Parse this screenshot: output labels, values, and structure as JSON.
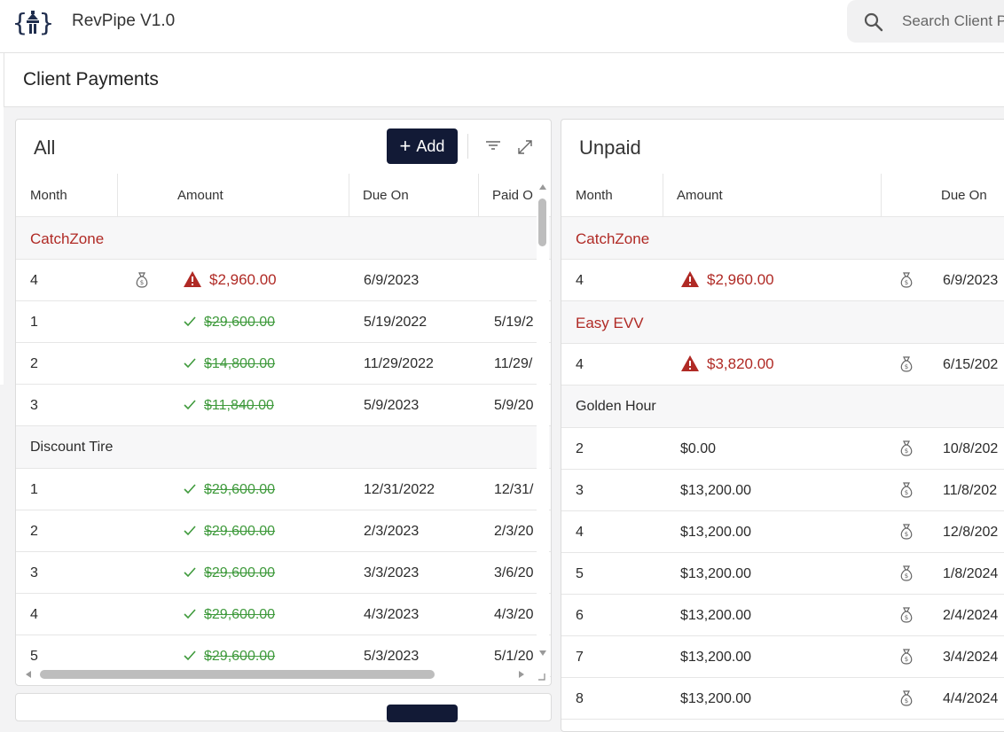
{
  "app": {
    "title": "RevPipe V1.0"
  },
  "search": {
    "placeholder": "Search Client P"
  },
  "page": {
    "title": "Client Payments"
  },
  "all_panel": {
    "title": "All",
    "add_label": "Add",
    "columns": [
      "Month",
      "Amount",
      "Due On",
      "Paid O"
    ],
    "rows": [
      {
        "type": "group",
        "name": "CatchZone",
        "color": "#b02a25"
      },
      {
        "type": "data",
        "month": "4",
        "status": "overdue",
        "money_icon": true,
        "amount": "$2,960.00",
        "due": "6/9/2023",
        "paid": ""
      },
      {
        "type": "data",
        "month": "1",
        "status": "paid",
        "amount": "$29,600.00",
        "due": "5/19/2022",
        "paid": "5/19/2"
      },
      {
        "type": "data",
        "month": "2",
        "status": "paid",
        "amount": "$14,800.00",
        "due": "11/29/2022",
        "paid": "11/29/"
      },
      {
        "type": "data",
        "month": "3",
        "status": "paid",
        "amount": "$11,840.00",
        "due": "5/9/2023",
        "paid": "5/9/20"
      },
      {
        "type": "group",
        "name": "Discount Tire",
        "color": "#2b2b2b"
      },
      {
        "type": "data",
        "month": "1",
        "status": "paid",
        "amount": "$29,600.00",
        "due": "12/31/2022",
        "paid": "12/31/"
      },
      {
        "type": "data",
        "month": "2",
        "status": "paid",
        "amount": "$29,600.00",
        "due": "2/3/2023",
        "paid": "2/3/20"
      },
      {
        "type": "data",
        "month": "3",
        "status": "paid",
        "amount": "$29,600.00",
        "due": "3/3/2023",
        "paid": "3/6/20"
      },
      {
        "type": "data",
        "month": "4",
        "status": "paid",
        "amount": "$29,600.00",
        "due": "4/3/2023",
        "paid": "4/3/20"
      },
      {
        "type": "data",
        "month": "5",
        "status": "paid",
        "amount": "$29,600.00",
        "due": "5/3/2023",
        "paid": "5/1/20"
      }
    ]
  },
  "unpaid_panel": {
    "title": "Unpaid",
    "columns": [
      "Month",
      "Amount",
      "Due On"
    ],
    "rows": [
      {
        "type": "group",
        "name": "CatchZone",
        "color": "#b02a25"
      },
      {
        "type": "data",
        "month": "4",
        "status": "overdue",
        "amount": "$2,960.00",
        "due": "6/9/2023"
      },
      {
        "type": "group",
        "name": "Easy EVV",
        "color": "#b02a25"
      },
      {
        "type": "data",
        "month": "4",
        "status": "overdue",
        "amount": "$3,820.00",
        "due": "6/15/202"
      },
      {
        "type": "group",
        "name": "Golden Hour",
        "color": "#2b2b2b"
      },
      {
        "type": "data",
        "month": "2",
        "status": "none",
        "amount": "$0.00",
        "due": "10/8/202"
      },
      {
        "type": "data",
        "month": "3",
        "status": "none",
        "amount": "$13,200.00",
        "due": "11/8/202"
      },
      {
        "type": "data",
        "month": "4",
        "status": "none",
        "amount": "$13,200.00",
        "due": "12/8/202"
      },
      {
        "type": "data",
        "month": "5",
        "status": "none",
        "amount": "$13,200.00",
        "due": "1/8/2024"
      },
      {
        "type": "data",
        "month": "6",
        "status": "none",
        "amount": "$13,200.00",
        "due": "2/4/2024"
      },
      {
        "type": "data",
        "month": "7",
        "status": "none",
        "amount": "$13,200.00",
        "due": "3/4/2024"
      },
      {
        "type": "data",
        "month": "8",
        "status": "none",
        "amount": "$13,200.00",
        "due": "4/4/2024"
      }
    ]
  },
  "colors": {
    "accent_navy": "#121a36",
    "overdue_red": "#b02a25",
    "paid_green": "#3f9a3c"
  },
  "icons": [
    "logo-icon",
    "search-icon",
    "filter-icon",
    "expand-icon",
    "money-bag-icon",
    "warning-icon",
    "check-icon"
  ]
}
